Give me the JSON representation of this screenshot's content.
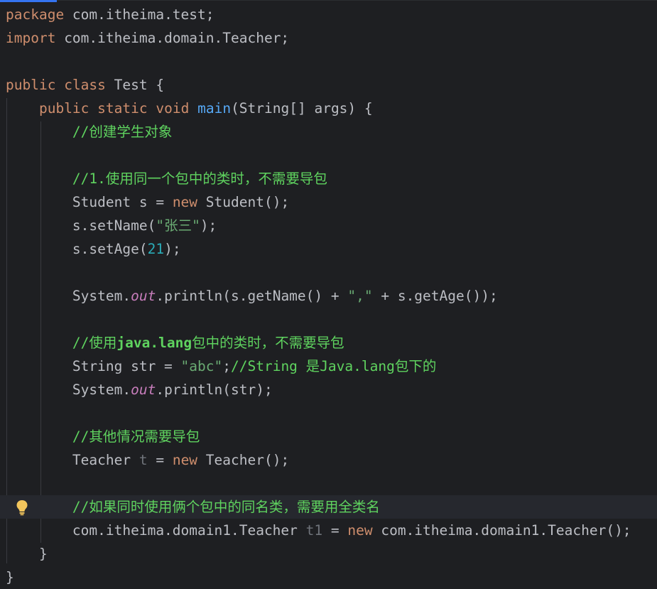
{
  "colors": {
    "background": "#1e1f22",
    "keyword": "#cf8e6d",
    "method_declaration": "#56a8f5",
    "string": "#6aab73",
    "number": "#2aacb8",
    "comment": "#5fd35f",
    "static_field": "#c77dbb",
    "unused_variable": "#6f737a",
    "default_text": "#bcbec4",
    "caret_row_highlight": "#26282e"
  },
  "icons": {
    "intention_bulb": "lightbulb-icon"
  },
  "code": {
    "line1": {
      "kw": "package",
      "rest": " com.itheima.test;"
    },
    "line2": {
      "kw": "import",
      "rest": " com.itheima.domain.Teacher;"
    },
    "line4": {
      "kw1": "public",
      "kw2": "class",
      "rest": " Test {"
    },
    "line5": {
      "indent": "    ",
      "kw1": "public",
      "kw2": "static",
      "kw3": "void",
      "fn": "main",
      "rest": "(String[] args) {"
    },
    "line6": {
      "indent": "        ",
      "comment": "//创建学生对象"
    },
    "line8": {
      "indent": "        ",
      "comment": "//1.使用同一个包中的类时，不需要导包"
    },
    "line9": {
      "indent": "        ",
      "a": "Student s = ",
      "kw": "new",
      "b": " Student();"
    },
    "line10": {
      "indent": "        ",
      "a": "s.setName(",
      "str": "\"张三\"",
      "b": ");"
    },
    "line11": {
      "indent": "        ",
      "a": "s.setAge(",
      "num": "21",
      "b": ");"
    },
    "line13": {
      "indent": "        ",
      "a": "System.",
      "field": "out",
      "b": ".println(s.getName() + ",
      "str": "\",\"",
      "c": " + s.getAge());"
    },
    "line15": {
      "indent": "        ",
      "c1": "//使用",
      "c2": "java.lang",
      "c3": "包中的类时，不需要导包"
    },
    "line16": {
      "indent": "        ",
      "a": "String str = ",
      "str": "\"abc\"",
      "b": ";",
      "c1": "//",
      "c2": "String",
      "c3": " 是",
      "c4": "Java.lang",
      "c5": "包下的"
    },
    "line17": {
      "indent": "        ",
      "a": "System.",
      "field": "out",
      "b": ".println(str);"
    },
    "line19": {
      "indent": "        ",
      "comment": "//其他情况需要导包"
    },
    "line20": {
      "indent": "        ",
      "a": "Teacher ",
      "var": "t",
      "b": " = ",
      "kw": "new",
      "c": " Teacher();"
    },
    "line22": {
      "indent": "        ",
      "comment": "//如果同时使用俩个包中的同名类，需要用全类名"
    },
    "line23": {
      "indent": "        ",
      "a": "com.itheima.domain1.Teacher ",
      "var": "t1",
      "b": " = ",
      "kw": "new",
      "c": " com.itheima.domain1.Teacher();"
    },
    "line24": {
      "indent": "    ",
      "a": "}"
    },
    "line25": {
      "a": "}"
    }
  }
}
